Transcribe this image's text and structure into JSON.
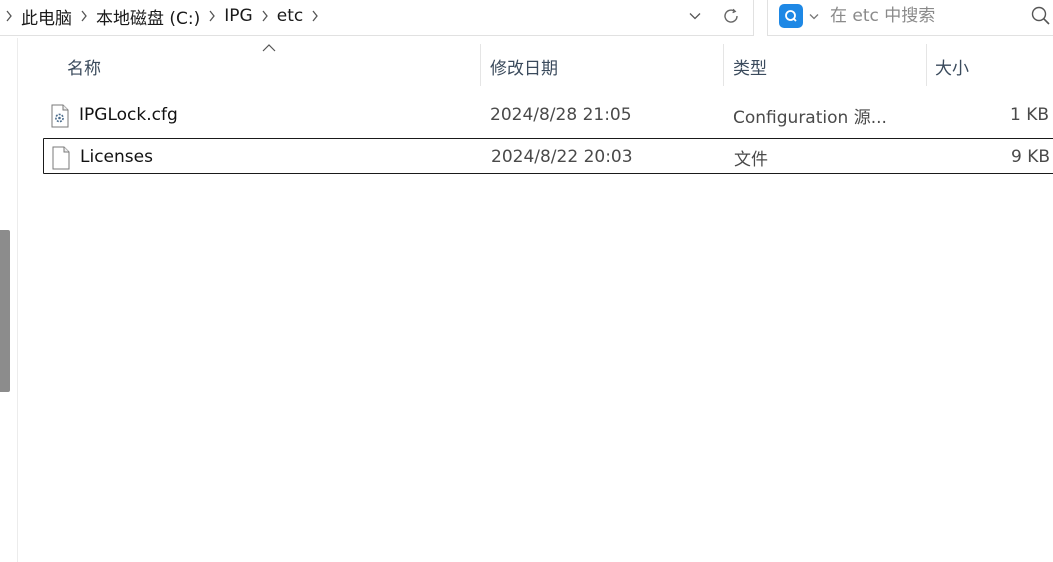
{
  "breadcrumb": {
    "items": [
      "此电脑",
      "本地磁盘 (C:)",
      "IPG",
      "etc"
    ]
  },
  "search": {
    "placeholder": "在 etc 中搜索",
    "engine_icon": "search-engine-icon",
    "accent": "#1e88e5"
  },
  "columns": {
    "name": "名称",
    "modified": "修改日期",
    "type": "类型",
    "size": "大小"
  },
  "files": [
    {
      "name": "IPGLock.cfg",
      "modified": "2024/8/28 21:05",
      "type": "Configuration 源...",
      "size": "1 KB",
      "icon": "config-file-icon",
      "selected": false
    },
    {
      "name": "Licenses",
      "modified": "2024/8/22 20:03",
      "type": "文件",
      "size": "9 KB",
      "icon": "file-icon",
      "selected": true
    }
  ]
}
